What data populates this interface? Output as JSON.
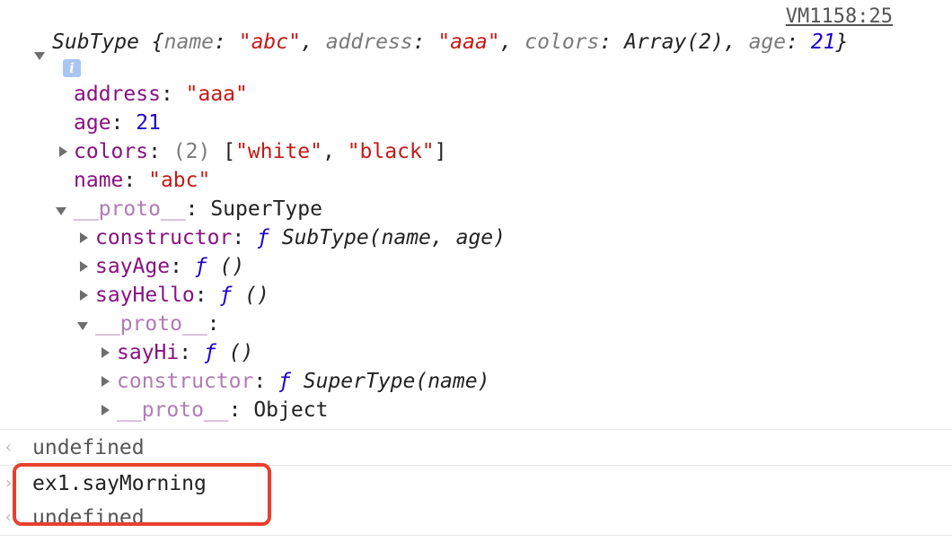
{
  "console": {
    "source_link": "VM1158:25",
    "summary": {
      "type": "SubType",
      "open_brace": " {",
      "k_name": "name",
      "v_name": "\"abc\"",
      "k_address": "address",
      "v_address": "\"aaa\"",
      "k_colors": "colors",
      "v_colors": "Array(2)",
      "k_age": "age",
      "v_age": "21",
      "close_brace": "}",
      "colon_sp": ": ",
      "comma_sp": ", "
    },
    "info_icon_glyph": "i",
    "props": {
      "address_key": "address",
      "address_val": "\"aaa\"",
      "age_key": "age",
      "age_val": "21",
      "colors_key": "colors",
      "colors_len": "(2)",
      "colors_open": "[",
      "colors_v1": "\"white\"",
      "colors_sep": ", ",
      "colors_v2": "\"black\"",
      "colors_close": "]",
      "name_key": "name",
      "name_val": "\"abc\"",
      "proto_key": "__proto__",
      "proto_val": "SuperType",
      "colon": ": "
    },
    "proto1": {
      "constructor_key": "constructor",
      "constructor_f": "ƒ",
      "constructor_sig": " SubType(name, age)",
      "sayAge_key": "sayAge",
      "sayHello_key": "sayHello",
      "f": "ƒ",
      "empty_args": " ()",
      "proto_key": "__proto__",
      "colon": ": "
    },
    "proto2": {
      "sayHi_key": "sayHi",
      "constructor_key": "constructor",
      "constructor_sig": " SuperType(name)",
      "proto_key": "__proto__",
      "proto_val": "Object"
    },
    "results": [
      {
        "text": "undefined"
      }
    ],
    "input": {
      "text": "ex1.sayMorning"
    },
    "last_result": {
      "text": "undefined"
    },
    "chevron_out": "‹",
    "chevron_in": "›"
  }
}
